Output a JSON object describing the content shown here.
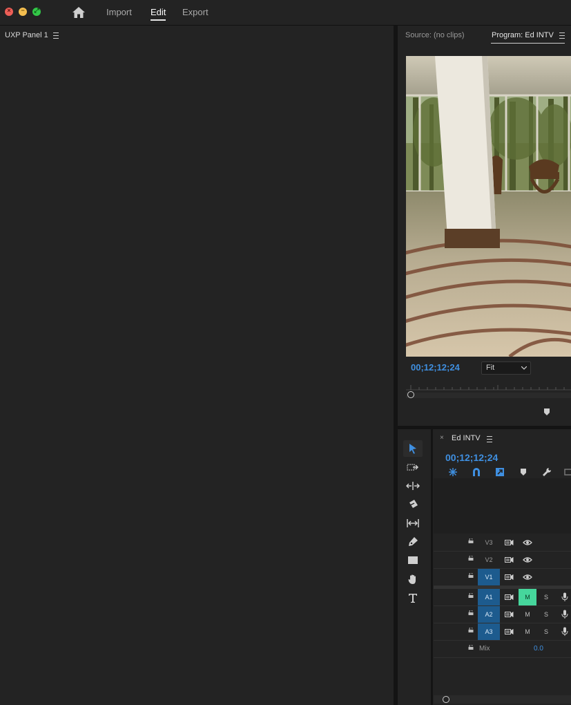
{
  "topbar": {
    "tabs": [
      {
        "label": "Import"
      },
      {
        "label": "Edit"
      },
      {
        "label": "Export"
      }
    ],
    "active_tab": "Edit",
    "traffic_lights": {
      "close": "×",
      "minimize": "−",
      "zoom": "⤢"
    }
  },
  "left_panel": {
    "title": "UXP Panel 1"
  },
  "monitor": {
    "source_tab": "Source: (no clips)",
    "program_tab": "Program: Ed INTV",
    "timecode": "00;12;12;24",
    "zoom": {
      "selected": "Fit"
    }
  },
  "timeline": {
    "sequence_name": "Ed INTV",
    "close_glyph": "×",
    "timecode": "00;12;12;24",
    "video_tracks": [
      {
        "name": "V3",
        "targeted": false
      },
      {
        "name": "V2",
        "targeted": false
      },
      {
        "name": "V1",
        "targeted": true
      }
    ],
    "audio_tracks": [
      {
        "name": "A1",
        "targeted": true,
        "mute": "M",
        "solo": "S",
        "muted": true
      },
      {
        "name": "A2",
        "targeted": true,
        "mute": "M",
        "solo": "S",
        "muted": false
      },
      {
        "name": "A3",
        "targeted": true,
        "mute": "M",
        "solo": "S",
        "muted": false
      }
    ],
    "mix": {
      "label": "Mix",
      "value": "0.0"
    }
  },
  "colors": {
    "accent_blue": "#3f8fe0",
    "target_blue": "#1d5b8e",
    "mute_green": "#46d69c"
  }
}
